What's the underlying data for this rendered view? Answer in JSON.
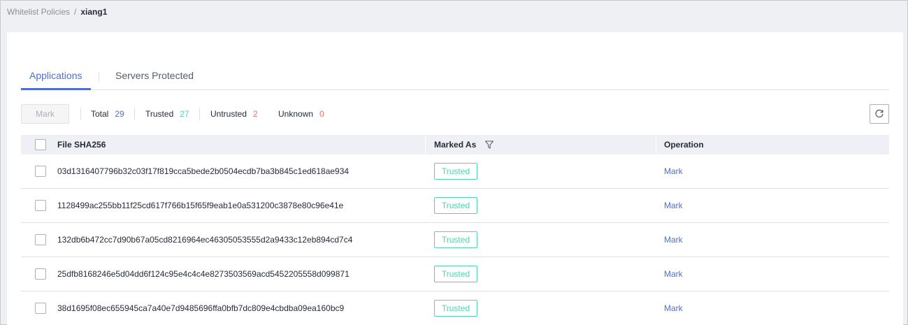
{
  "breadcrumb": {
    "parent": "Whitelist Policies",
    "separator": "/",
    "current": "xiang1"
  },
  "tabs": [
    {
      "label": "Applications",
      "active": true
    },
    {
      "label": "Servers Protected",
      "active": false
    }
  ],
  "toolbar": {
    "mark_label": "Mark",
    "stats": {
      "total_label": "Total",
      "total": "29",
      "trusted_label": "Trusted",
      "trusted": "27",
      "untrusted_label": "Untrusted",
      "untrusted": "2",
      "unknown_label": "Unknown",
      "unknown": "0"
    },
    "refresh_icon": "refresh-icon"
  },
  "table": {
    "headers": {
      "sha": "File SHA256",
      "marked_as": "Marked As",
      "operation": "Operation"
    },
    "rows": [
      {
        "sha": "03d1316407796b32c03f17f819cca5bede2b0504ecdb7ba3b845c1ed618ae934",
        "status": "Trusted",
        "op": "Mark"
      },
      {
        "sha": "1128499ac255bb11f25cd617f766b15f65f9eab1e0a531200c3878e80c96e41e",
        "status": "Trusted",
        "op": "Mark"
      },
      {
        "sha": "132db6b472cc7d90b67a05cd8216964ec46305053555d2a9433c12eb894cd7c4",
        "status": "Trusted",
        "op": "Mark"
      },
      {
        "sha": "25dfb8168246e5d04dd6f124c95e4c4c4e8273503569acd5452205558d099871",
        "status": "Trusted",
        "op": "Mark"
      },
      {
        "sha": "38d1695f08ec655945ca7a40e7d9485696ffa0bfb7dc809e4cbdba09ea160bc9",
        "status": "Trusted",
        "op": "Mark"
      }
    ]
  },
  "colors": {
    "accent": "#526ecc",
    "trusted": "#50d4ab",
    "untrusted": "#f66f6a"
  }
}
